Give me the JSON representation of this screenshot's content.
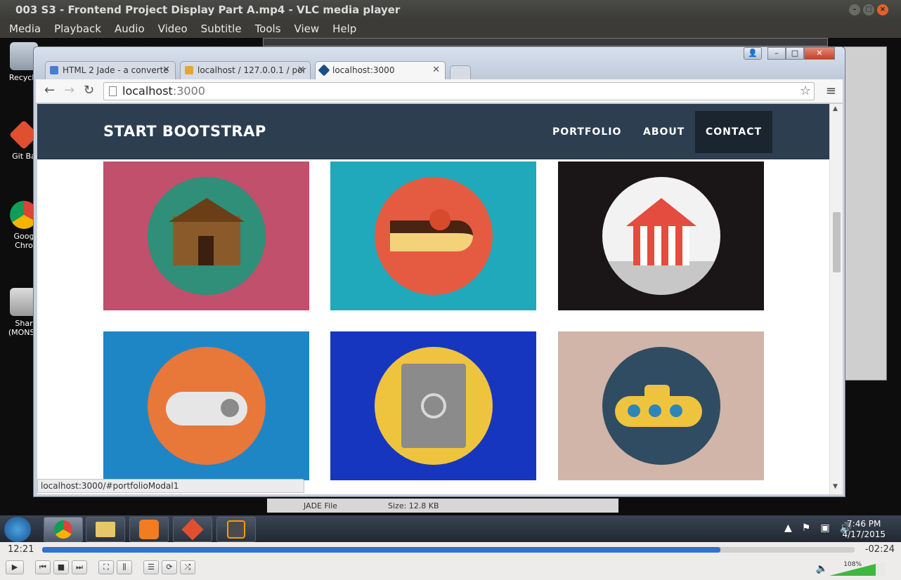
{
  "vlc": {
    "title": "003 S3 - Frontend Project Display Part A.mp4 - VLC media player",
    "menu": [
      "Media",
      "Playback",
      "Audio",
      "Video",
      "Subtitle",
      "Tools",
      "View",
      "Help"
    ],
    "elapsed": "12:21",
    "remaining": "-02:24",
    "progress": 0.835,
    "volume": "108%"
  },
  "desktop": {
    "icons": [
      "Recycle",
      "Git Ba",
      "Goog Chro",
      "Shar (MONST"
    ]
  },
  "browser": {
    "tabs": [
      {
        "label": "HTML 2 Jade - a converte",
        "favicon_color": "#4a7bd6"
      },
      {
        "label": "localhost / 127.0.0.1 / por",
        "favicon_color": "#e8a23a"
      },
      {
        "label": "localhost:3000",
        "favicon_color": "#1b4f86"
      }
    ],
    "url_host": "localhost",
    "url_port": ":3000",
    "status_url": "localhost:3000/#portfolioModal1"
  },
  "site": {
    "brand": "START BOOTSTRAP",
    "nav": [
      "PORTFOLIO",
      "ABOUT",
      "CONTACT"
    ],
    "portfolio": [
      {
        "name": "cabin",
        "bg": "#c0506c",
        "circle": "#2f8f78",
        "icon": "cabin-icon"
      },
      {
        "name": "cake",
        "bg": "#1fa9ba",
        "circle": "#e45b42",
        "icon": "cake-icon"
      },
      {
        "name": "circus",
        "bg": "#1a1516",
        "circle": "#f2f2f2",
        "icon": "circus-tent-icon"
      },
      {
        "name": "game",
        "bg": "#1f86c6",
        "circle": "#e8773a",
        "icon": "game-controller-icon"
      },
      {
        "name": "safe",
        "bg": "#1736c0",
        "circle": "#eec43e",
        "icon": "safe-icon"
      },
      {
        "name": "submarine",
        "bg": "#d0b5a8",
        "circle": "#2f4c62",
        "icon": "submarine-icon"
      }
    ]
  },
  "taskbar": {
    "time": "7:46 PM",
    "date": "4/17/2015"
  },
  "partial_text": {
    "jade_file": "JADE File",
    "size": "Size: 12.8 KB"
  }
}
